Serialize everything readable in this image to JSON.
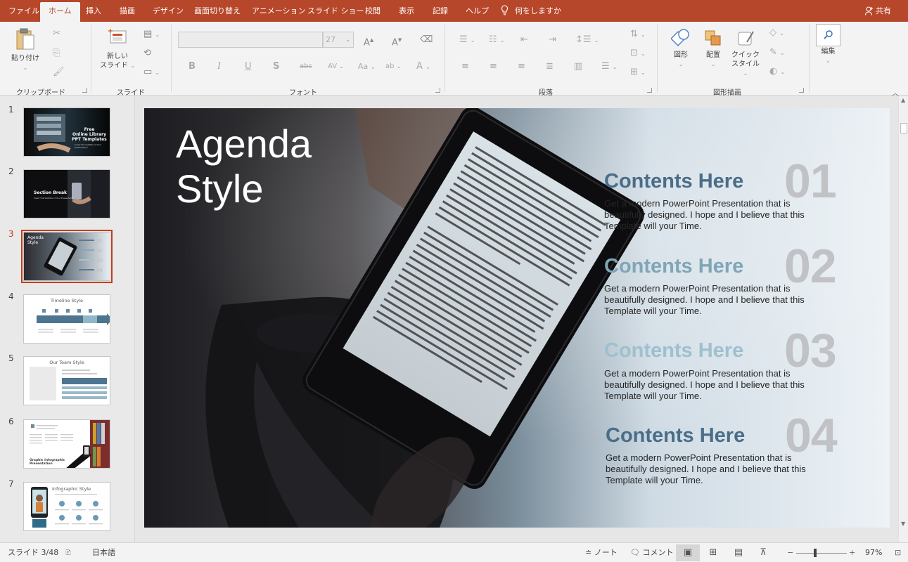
{
  "tabs": [
    {
      "label": "ファイル"
    },
    {
      "label": "ホーム"
    },
    {
      "label": "挿入"
    },
    {
      "label": "描画"
    },
    {
      "label": "デザイン"
    },
    {
      "label": "画面切り替え"
    },
    {
      "label": "アニメーション"
    },
    {
      "label": "スライド ショー"
    },
    {
      "label": "校閲"
    },
    {
      "label": "表示"
    },
    {
      "label": "記録"
    },
    {
      "label": "ヘルプ"
    }
  ],
  "tell_me": "何をしますか",
  "share": "共有",
  "ribbon": {
    "paste": "貼り付け",
    "new_slide_line1": "新しい",
    "new_slide_line2": "スライド",
    "font_size": "27",
    "shapes": "図形",
    "arrange": "配置",
    "quick_style_line1": "クイック",
    "quick_style_line2": "スタイル",
    "editing": "編集",
    "groups": {
      "clipboard": "クリップボード",
      "slides": "スライド",
      "font": "フォント",
      "paragraph": "段落",
      "drawing": "図形描画"
    }
  },
  "thumbnails": [
    {
      "num": "1",
      "title": "Free\nOnline Library\nPPT Templates",
      "sub": "Insert the Subtitle of Your Presentation"
    },
    {
      "num": "2",
      "title": "Section Break",
      "sub": "Insert the Subtitle of Your Presentation"
    },
    {
      "num": "3",
      "title": "Agenda\nStyle"
    },
    {
      "num": "4",
      "title": "Timeline Style"
    },
    {
      "num": "5",
      "title": "Our Team Style"
    },
    {
      "num": "6",
      "title": "Graphic Infographic\nPresentation"
    },
    {
      "num": "7",
      "title": "Infographic Style"
    }
  ],
  "slide": {
    "title": "Agenda\nStyle",
    "items": [
      {
        "heading": "Contents Here",
        "number": "01",
        "body": "Get a modern PowerPoint  Presentation that is beautifully designed. I hope and I believe that this Template will your Time.",
        "color": "#4a6d88"
      },
      {
        "heading": "Contents Here",
        "number": "02",
        "body": "Get a modern PowerPoint  Presentation that is beautifully designed. I hope and I believe that this Template will your Time.",
        "color": "#7fa6b6"
      },
      {
        "heading": "Contents Here",
        "number": "03",
        "body": "Get a modern PowerPoint  Presentation that is beautifully designed. I hope and I believe that this Template will your Time.",
        "color": "#9ec0cf"
      },
      {
        "heading": "Contents Here",
        "number": "04",
        "body": "Get a modern PowerPoint  Presentation that is beautifully designed. I hope and I believe that this Template will your Time.",
        "color": "#4a6d88"
      }
    ]
  },
  "status": {
    "slide_counter": "スライド 3/48",
    "language": "日本語",
    "notes": "ノート",
    "comments": "コメント",
    "zoom": "97%"
  },
  "colors": {
    "accent": "#b7472a",
    "selection": "#c43e1c"
  }
}
